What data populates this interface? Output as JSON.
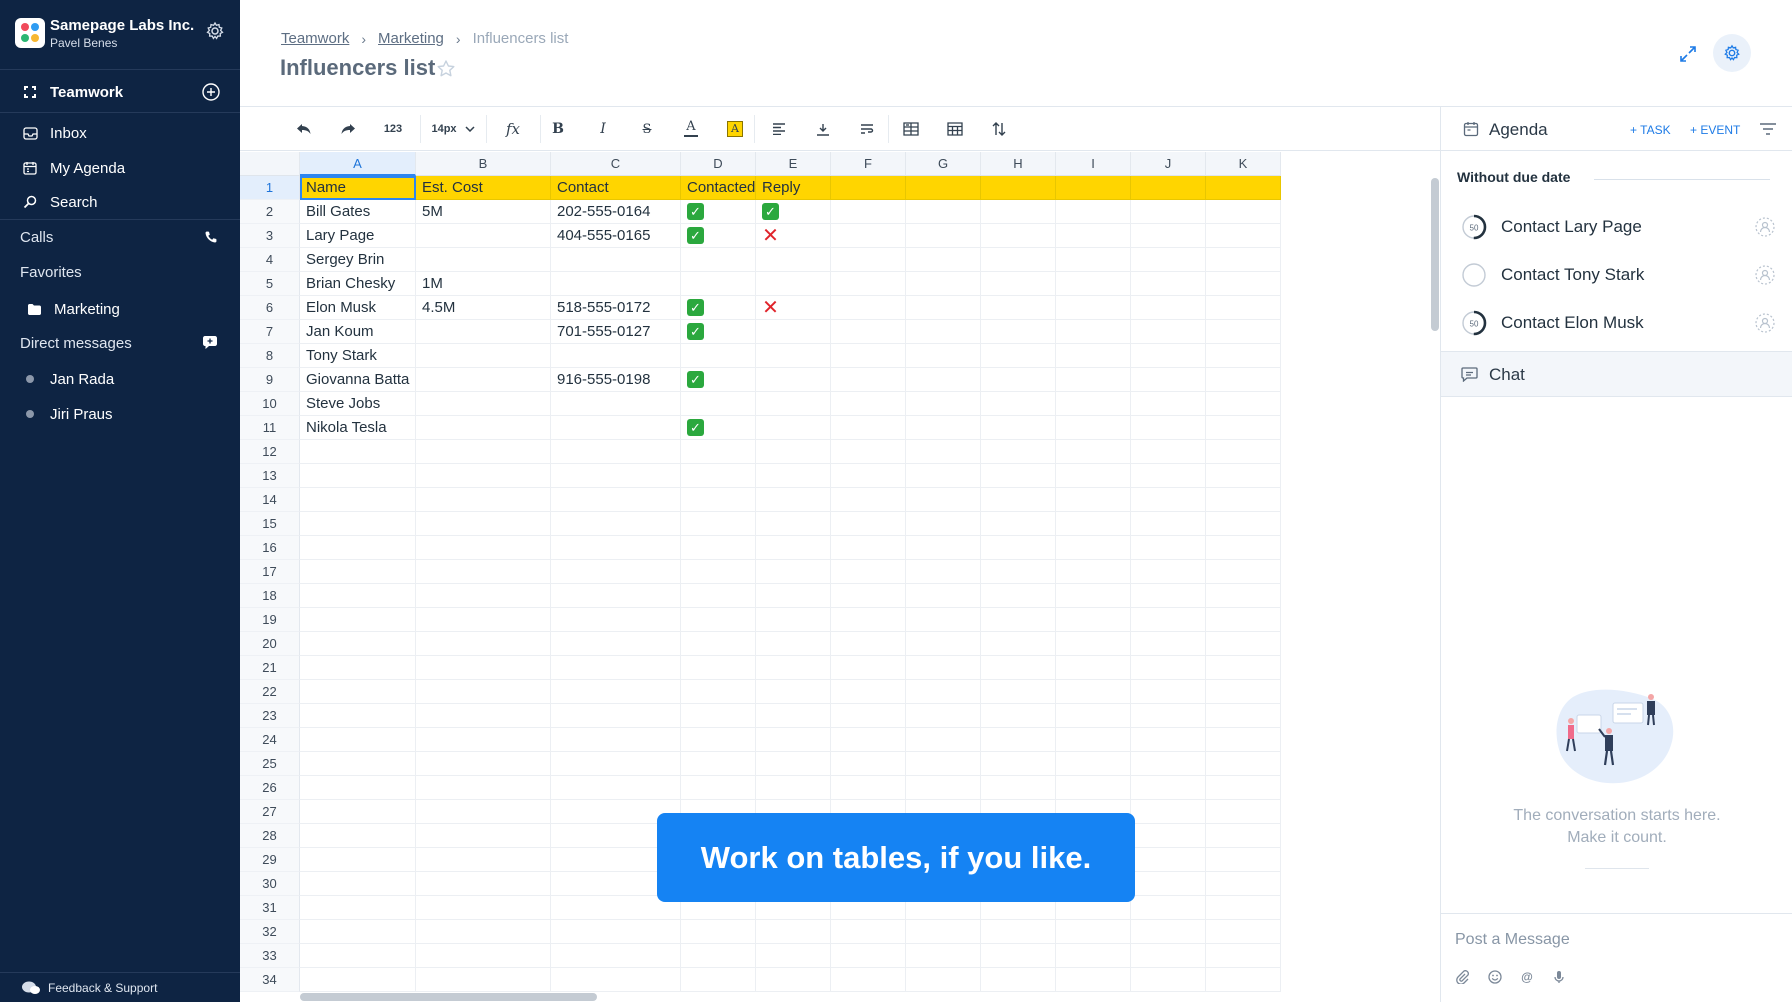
{
  "sidebar": {
    "org_name": "Samepage Labs Inc.",
    "user_name": "Pavel Benes",
    "workspace": "Teamwork",
    "nav": [
      {
        "label": "Inbox",
        "icon": "inbox-icon"
      },
      {
        "label": "My Agenda",
        "icon": "calendar-icon"
      },
      {
        "label": "Search",
        "icon": "search-icon"
      }
    ],
    "calls_label": "Calls",
    "favorites_label": "Favorites",
    "favorites": [
      {
        "label": "Marketing",
        "icon": "folder-icon"
      }
    ],
    "dm_label": "Direct messages",
    "dms": [
      {
        "label": "Jan Rada"
      },
      {
        "label": "Jiri Praus"
      }
    ],
    "feedback_label": "Feedback & Support"
  },
  "header": {
    "breadcrumb": [
      "Teamwork",
      "Marketing",
      "Influencers list"
    ],
    "title": "Influencers list"
  },
  "toolbar": {
    "number_format": "123",
    "font_size": "14px",
    "formula": "fx",
    "bold": "B",
    "italic": "I",
    "strike": "S",
    "text_color_letter": "A",
    "fill_color": "#ffd500"
  },
  "sheet": {
    "columns": [
      "A",
      "B",
      "C",
      "D",
      "E",
      "F",
      "G",
      "H",
      "I",
      "J",
      "K"
    ],
    "selected_column": "A",
    "selected_row": "1",
    "header_fill": "#ffd500",
    "row_numbers": [
      "1",
      "2",
      "3",
      "4",
      "5",
      "6",
      "7",
      "8",
      "9",
      "10",
      "11",
      "12",
      "13",
      "14",
      "15",
      "16",
      "17",
      "18",
      "19",
      "20",
      "21",
      "22",
      "23",
      "24",
      "25",
      "26",
      "27",
      "28",
      "29",
      "30",
      "31",
      "32",
      "33",
      "34"
    ],
    "rows": [
      [
        "Name",
        "Est. Cost",
        "Contact",
        "Contacted",
        "Reply"
      ],
      [
        "Bill Gates",
        "5M",
        "202-555-0164",
        "yes",
        "yes"
      ],
      [
        "Lary Page",
        "",
        "404-555-0165",
        "yes",
        "no"
      ],
      [
        "Sergey Brin",
        "",
        "",
        "",
        ""
      ],
      [
        "Brian Chesky",
        "1M",
        "",
        "",
        ""
      ],
      [
        "Elon Musk",
        "4.5M",
        "518-555-0172",
        "yes",
        "no"
      ],
      [
        "Jan Koum",
        "",
        "701-555-0127",
        "yes",
        ""
      ],
      [
        "Tony Stark",
        "",
        "",
        "",
        ""
      ],
      [
        "Giovanna Batta",
        "",
        "916-555-0198",
        "yes",
        ""
      ],
      [
        "Steve Jobs",
        "",
        "",
        "",
        ""
      ],
      [
        "Nikola Tesla",
        "",
        "",
        "yes",
        ""
      ]
    ]
  },
  "promo": {
    "text": "Work on tables, if you like."
  },
  "agenda": {
    "title": "Agenda",
    "add_task": "TASK",
    "add_event": "EVENT",
    "section": "Without due date",
    "tasks": [
      {
        "label": "Contact Lary Page",
        "progress": 50,
        "progress_label": "50"
      },
      {
        "label": "Contact Tony Stark",
        "progress": 0,
        "progress_label": ""
      },
      {
        "label": "Contact Elon Musk",
        "progress": 50,
        "progress_label": "50"
      }
    ]
  },
  "chat": {
    "title": "Chat",
    "empty_line1": "The conversation starts here.",
    "empty_line2": "Make it count.",
    "placeholder": "Post a Message"
  },
  "colors": {
    "sidebar_bg": "#0e2443",
    "accent": "#1583f3",
    "header_row": "#ffd500",
    "check": "#2ba83e",
    "cross": "#e0242b"
  }
}
